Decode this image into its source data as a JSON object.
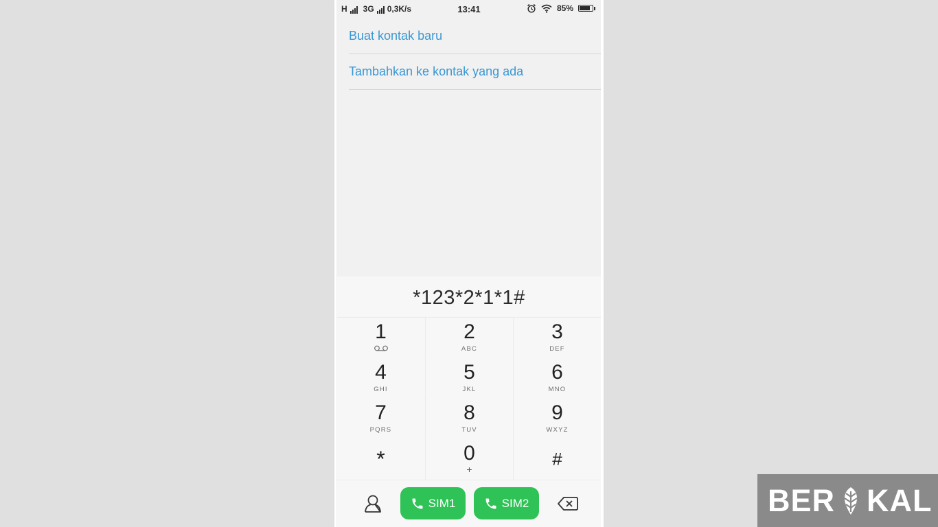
{
  "status_bar": {
    "network_1": "H",
    "network_2": "3G",
    "speed": "0,3K/s",
    "time": "13:41",
    "battery_percent": "85%",
    "battery_level": 0.85,
    "icons": [
      "signal-icon",
      "alarm-icon",
      "wifi-icon",
      "battery-icon"
    ]
  },
  "options": [
    {
      "label": "Buat kontak baru"
    },
    {
      "label": "Tambahkan ke kontak yang ada"
    }
  ],
  "dialer": {
    "number": "*123*2*1*1#",
    "keys": [
      {
        "digit": "1",
        "letters": "",
        "icon": "voicemail-icon"
      },
      {
        "digit": "2",
        "letters": "ABC"
      },
      {
        "digit": "3",
        "letters": "DEF"
      },
      {
        "digit": "4",
        "letters": "GHI"
      },
      {
        "digit": "5",
        "letters": "JKL"
      },
      {
        "digit": "6",
        "letters": "MNO"
      },
      {
        "digit": "7",
        "letters": "PQRS"
      },
      {
        "digit": "8",
        "letters": "TUV"
      },
      {
        "digit": "9",
        "letters": "WXYZ"
      },
      {
        "digit": "*",
        "letters": ""
      },
      {
        "digit": "0",
        "letters": "+"
      },
      {
        "digit": "#",
        "letters": ""
      }
    ],
    "sim1_label": "SIM1",
    "sim2_label": "SIM2",
    "call_color": "#2fc256",
    "link_color": "#3a98d3"
  },
  "watermark": {
    "text_before": "BER",
    "text_after": "KAL"
  }
}
